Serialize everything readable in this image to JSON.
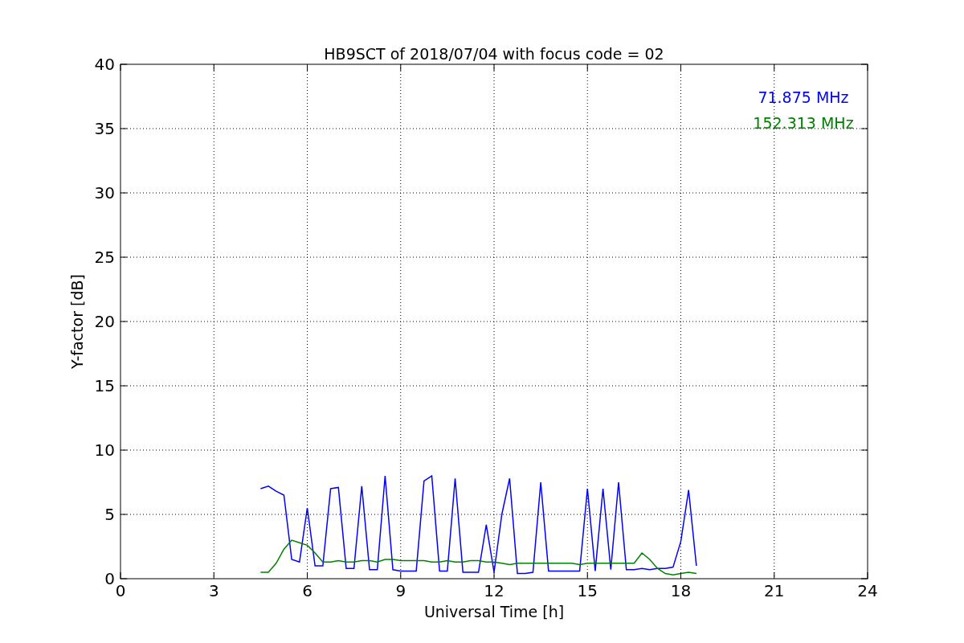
{
  "chart_data": {
    "type": "line",
    "title": "HB9SCT of 2018/07/04 with focus code = 02",
    "xlabel": "Universal Time [h]",
    "ylabel": "Y-factor [dB]",
    "x": [
      4.5,
      4.75,
      5.0,
      5.25,
      5.5,
      5.75,
      6.0,
      6.25,
      6.5,
      6.75,
      7.0,
      7.25,
      7.5,
      7.75,
      8.0,
      8.25,
      8.5,
      8.75,
      9.0,
      9.25,
      9.5,
      9.75,
      10.0,
      10.25,
      10.5,
      10.75,
      11.0,
      11.25,
      11.5,
      11.75,
      12.0,
      12.25,
      12.5,
      12.75,
      13.0,
      13.25,
      13.5,
      13.75,
      14.0,
      14.25,
      14.5,
      14.75,
      15.0,
      15.25,
      15.5,
      15.75,
      16.0,
      16.25,
      16.5,
      16.75,
      17.0,
      17.25,
      17.5,
      17.75,
      18.0,
      18.25,
      18.5
    ],
    "series": [
      {
        "name": "71.875 MHz",
        "color": "#0000ff",
        "values": [
          7.0,
          7.2,
          6.8,
          6.5,
          1.5,
          1.3,
          5.5,
          1.0,
          1.0,
          7.0,
          7.1,
          0.8,
          0.8,
          7.2,
          0.7,
          0.7,
          8.0,
          0.7,
          0.6,
          0.6,
          0.6,
          7.6,
          8.0,
          0.6,
          0.6,
          7.8,
          0.5,
          0.5,
          0.5,
          4.2,
          0.5,
          5.0,
          7.8,
          0.4,
          0.4,
          0.5,
          7.5,
          0.6,
          0.6,
          0.6,
          0.6,
          0.6,
          7.0,
          0.6,
          7.0,
          0.7,
          7.5,
          0.7,
          0.7,
          0.8,
          0.7,
          0.8,
          0.8,
          0.9,
          2.9,
          6.9,
          1.0
        ]
      },
      {
        "name": "152.313 MHz",
        "color": "#008000",
        "values": [
          0.5,
          0.5,
          1.2,
          2.3,
          3.0,
          2.8,
          2.6,
          2.0,
          1.3,
          1.3,
          1.4,
          1.3,
          1.3,
          1.4,
          1.4,
          1.3,
          1.5,
          1.5,
          1.4,
          1.4,
          1.4,
          1.4,
          1.3,
          1.3,
          1.4,
          1.3,
          1.3,
          1.4,
          1.4,
          1.3,
          1.3,
          1.2,
          1.1,
          1.2,
          1.2,
          1.2,
          1.2,
          1.2,
          1.2,
          1.2,
          1.2,
          1.1,
          1.2,
          1.2,
          1.2,
          1.2,
          1.2,
          1.2,
          1.2,
          2.0,
          1.5,
          0.8,
          0.4,
          0.3,
          0.4,
          0.5,
          0.4
        ]
      }
    ],
    "xlim": [
      0,
      24
    ],
    "ylim": [
      0,
      40
    ],
    "xticks": [
      0,
      3,
      6,
      9,
      12,
      15,
      18,
      21,
      24
    ],
    "yticks": [
      0,
      5,
      10,
      15,
      20,
      25,
      30,
      35,
      40
    ],
    "grid": true
  }
}
